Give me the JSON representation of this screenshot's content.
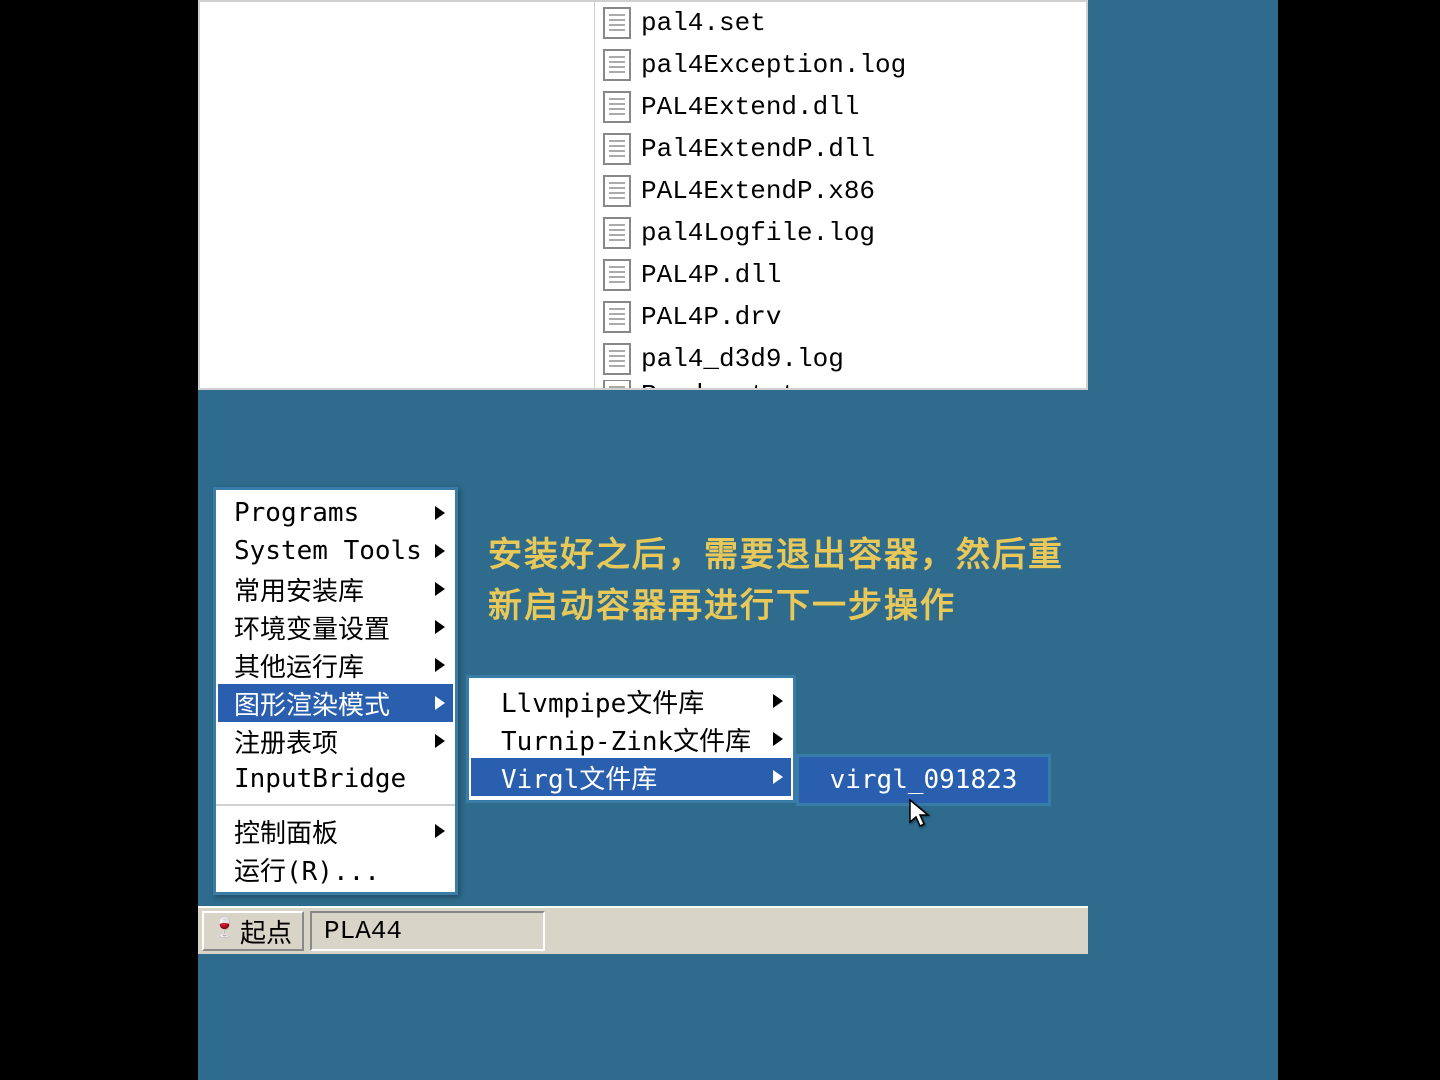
{
  "files": [
    "pal4.set",
    "pal4Exception.log",
    "PAL4Extend.dll",
    "Pal4ExtendP.dll",
    "PAL4ExtendP.x86",
    "pal4Logfile.log",
    "PAL4P.dll",
    "PAL4P.drv",
    "pal4_d3d9.log",
    "Readme.txt"
  ],
  "overlay": {
    "line1": "安装好之后，需要退出容器，然后重",
    "line2": "新启动容器再进行下一步操作"
  },
  "menu": {
    "items": [
      {
        "label": "Programs",
        "arrow": true
      },
      {
        "label": "System Tools",
        "arrow": true
      },
      {
        "label": "常用安装库",
        "arrow": true
      },
      {
        "label": "环境变量设置",
        "arrow": true
      },
      {
        "label": "其他运行库",
        "arrow": true
      },
      {
        "label": "图形渲染模式",
        "arrow": true,
        "highlighted": true
      },
      {
        "label": "注册表项",
        "arrow": true
      },
      {
        "label": "InputBridge",
        "arrow": false
      }
    ],
    "section2": [
      {
        "label": "控制面板",
        "arrow": true
      },
      {
        "label": "运行(R)...",
        "arrow": false
      }
    ]
  },
  "submenu": [
    {
      "label": "Llvmpipe文件库",
      "arrow": true
    },
    {
      "label": "Turnip-Zink文件库",
      "arrow": true
    },
    {
      "label": "Virgl文件库",
      "arrow": true,
      "highlighted": true
    }
  ],
  "submenu2": [
    {
      "label": "virgl_091823"
    }
  ],
  "taskbar": {
    "start": "起点",
    "app": "PLA44"
  }
}
